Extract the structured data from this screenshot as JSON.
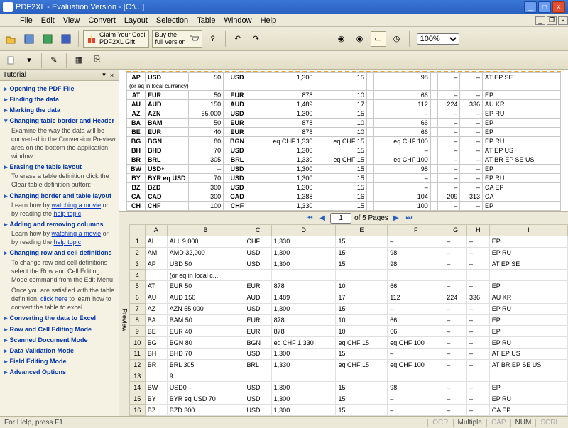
{
  "titlebar": {
    "app": "PDF2XL - Evaluation Version",
    "doc": "[C:\\...]"
  },
  "menu": [
    "File",
    "Edit",
    "View",
    "Convert",
    "Layout",
    "Selection",
    "Table",
    "Window",
    "Help"
  ],
  "toolbar": {
    "promo1a": "Claim Your Cool",
    "promo1b": "PDF2XL Gift",
    "promo2a": "Buy the",
    "promo2b": "full version",
    "zoom": "100%"
  },
  "tutorial": {
    "title": "Tutorial",
    "topics": [
      {
        "label": "Opening the PDF File",
        "open": false
      },
      {
        "label": "Finding the data",
        "open": false
      },
      {
        "label": "Marking the data",
        "open": false
      },
      {
        "label": "Changing table border and Header",
        "open": true,
        "body": "Examine the way the data will be converted in the Conversion Preview area on the bottom the application window."
      },
      {
        "label": "Erasing the table layout",
        "open": false,
        "body": "To erase a table definition click the Clear table definition button:"
      },
      {
        "label": "Changing border and table layout",
        "open": false,
        "body": "Learn how by watching a movie or by reading the help topic."
      },
      {
        "label": "Adding and removing columns",
        "open": false,
        "body": "Learn how by watching a movie or by reading the help topic."
      },
      {
        "label": "Changing row and cell definitions",
        "open": false,
        "body": "To change row and cell definitions select the Row and Cell Editing Mode command from the Edit Menu:"
      },
      {
        "label": "",
        "open": false,
        "body": "Once you are satisfied with the table definition, click here to learn how to convert the table to excel."
      },
      {
        "label": "Converting the data to Excel",
        "open": false
      },
      {
        "label": "Row and Cell Editing Mode",
        "open": false
      },
      {
        "label": "Scanned Document Mode",
        "open": false
      },
      {
        "label": "Data Validation Mode",
        "open": false
      },
      {
        "label": "Field Editing Mode",
        "open": false
      },
      {
        "label": "Advanced Options",
        "open": false
      }
    ]
  },
  "pdf_table": {
    "note": "(or eq in local currency)",
    "rows": [
      {
        "c": "AP",
        "cur": "USD",
        "v1": "50",
        "cur2": "USD",
        "v2": "1,300",
        "v3": "15",
        "v4": "",
        "v5": "98",
        "v6": "",
        "v7": "–",
        "v8": "–",
        "tx": "AT EP SE"
      },
      {
        "c": "AT",
        "cur": "EUR",
        "v1": "50",
        "cur2": "EUR",
        "v2": "878",
        "v3": "10",
        "v4": "",
        "v5": "66",
        "v6": "",
        "v7": "–",
        "v8": "–",
        "tx": "EP"
      },
      {
        "c": "AU",
        "cur": "AUD",
        "v1": "150",
        "cur2": "AUD",
        "v2": "1,489",
        "v3": "17",
        "v4": "",
        "v5": "112",
        "v6": "",
        "v7": "224",
        "v8": "336",
        "tx": "AU KR"
      },
      {
        "c": "AZ",
        "cur": "AZN",
        "v1": "55,000",
        "cur2": "USD",
        "v2": "1,300",
        "v3": "15",
        "v4": "",
        "v5": "–",
        "v6": "",
        "v7": "–",
        "v8": "–",
        "tx": "EP RU"
      },
      {
        "c": "BA",
        "cur": "BAM",
        "v1": "50",
        "cur2": "EUR",
        "v2": "878",
        "v3": "10",
        "v4": "",
        "v5": "66",
        "v6": "",
        "v7": "–",
        "v8": "–",
        "tx": "EP"
      },
      {
        "c": "BE",
        "cur": "EUR",
        "v1": "40",
        "cur2": "EUR",
        "v2": "878",
        "v3": "10",
        "v4": "",
        "v5": "66",
        "v6": "",
        "v7": "–",
        "v8": "–",
        "tx": "EP"
      },
      {
        "c": "BG",
        "cur": "BGN",
        "v1": "80",
        "cur2": "BGN",
        "v2": "eq CHF 1,330",
        "v3": "eq CHF 15",
        "v4": "",
        "v5": "eq CHF 100",
        "v6": "",
        "v7": "–",
        "v8": "–",
        "tx": "EP RU"
      },
      {
        "c": "BH",
        "cur": "BHD",
        "v1": "70",
        "cur2": "USD",
        "v2": "1,300",
        "v3": "15",
        "v4": "",
        "v5": "–",
        "v6": "",
        "v7": "–",
        "v8": "–",
        "tx": "AT EP US"
      },
      {
        "c": "BR",
        "cur": "BRL",
        "v1": "305",
        "cur2": "BRL",
        "v2": "1,330",
        "v3": "eq CHF 15",
        "v4": "",
        "v5": "eq CHF 100",
        "v6": "",
        "v7": "–",
        "v8": "–",
        "tx": "AT BR EP SE US"
      },
      {
        "c": "BW",
        "cur": "USD⁹",
        "v1": "–",
        "cur2": "USD",
        "v2": "1,300",
        "v3": "15",
        "v4": "",
        "v5": "98",
        "v6": "",
        "v7": "–",
        "v8": "–",
        "tx": "EP"
      },
      {
        "c": "BY",
        "cur": "BYR eq USD",
        "v1": "70",
        "cur2": "USD",
        "v2": "1,300",
        "v3": "15",
        "v4": "",
        "v5": "–",
        "v6": "",
        "v7": "–",
        "v8": "–",
        "tx": "EP RU"
      },
      {
        "c": "BZ",
        "cur": "BZD",
        "v1": "300",
        "cur2": "USD",
        "v2": "1,300",
        "v3": "15",
        "v4": "",
        "v5": "–",
        "v6": "",
        "v7": "–",
        "v8": "–",
        "tx": "CA EP"
      },
      {
        "c": "CA",
        "cur": "CAD",
        "v1": "300",
        "cur2": "CAD",
        "v2": "1,388",
        "v3": "16",
        "v4": "",
        "v5": "104",
        "v6": "",
        "v7": "209",
        "v8": "313",
        "tx": "CA"
      },
      {
        "c": "CH",
        "cur": "CHF",
        "v1": "100",
        "cur2": "CHF",
        "v2": "1,330",
        "v3": "15",
        "v4": "",
        "v5": "100",
        "v6": "",
        "v7": "–",
        "v8": "–",
        "tx": "EP"
      }
    ]
  },
  "pager": {
    "current": "1",
    "total": "of 5 Pages"
  },
  "sheet": {
    "cols": [
      "A",
      "B",
      "C",
      "D",
      "E",
      "F",
      "G",
      "H",
      "I"
    ],
    "label": "Preview",
    "rows": [
      {
        "n": "1",
        "a": "AL",
        "b": "ALL 9,000",
        "c": "CHF",
        "d": "1,330",
        "e": "15",
        "f": "–",
        "g": "–",
        "h": "–",
        "i": "EP"
      },
      {
        "n": "2",
        "a": "AM",
        "b": "AMD 32,000",
        "c": "USD",
        "d": "1,300",
        "e": "15",
        "f": "98",
        "g": "–",
        "h": "–",
        "i": "EP RU"
      },
      {
        "n": "3",
        "a": "AP",
        "b": "USD 50",
        "c": "USD",
        "d": "1,300",
        "e": "15",
        "f": "98",
        "g": "–",
        "h": "–",
        "i": "AT EP SE"
      },
      {
        "n": "4",
        "a": "",
        "b": "(or eq in local c...",
        "c": "",
        "d": "",
        "e": "",
        "f": "",
        "g": "",
        "h": "",
        "i": ""
      },
      {
        "n": "5",
        "a": "AT",
        "b": "EUR 50",
        "c": "EUR",
        "d": "878",
        "e": "10",
        "f": "66",
        "g": "–",
        "h": "–",
        "i": "EP"
      },
      {
        "n": "6",
        "a": "AU",
        "b": "AUD 150",
        "c": "AUD",
        "d": "1,489",
        "e": "17",
        "f": "112",
        "g": "224",
        "h": "336",
        "i": "AU KR"
      },
      {
        "n": "7",
        "a": "AZ",
        "b": "AZN 55,000",
        "c": "USD",
        "d": "1,300",
        "e": "15",
        "f": "–",
        "g": "–",
        "h": "–",
        "i": "EP RU"
      },
      {
        "n": "8",
        "a": "BA",
        "b": "BAM 50",
        "c": "EUR",
        "d": "878",
        "e": "10",
        "f": "66",
        "g": "–",
        "h": "–",
        "i": "EP"
      },
      {
        "n": "9",
        "a": "BE",
        "b": "EUR 40",
        "c": "EUR",
        "d": "878",
        "e": "10",
        "f": "66",
        "g": "–",
        "h": "–",
        "i": "EP"
      },
      {
        "n": "10",
        "a": "BG",
        "b": "BGN 80",
        "c": "BGN",
        "d": "eq CHF 1,330",
        "e": "eq CHF 15",
        "f": "eq CHF 100",
        "g": "–",
        "h": "–",
        "i": "EP RU"
      },
      {
        "n": "11",
        "a": "BH",
        "b": "BHD 70",
        "c": "USD",
        "d": "1,300",
        "e": "15",
        "f": "–",
        "g": "–",
        "h": "–",
        "i": "AT EP US"
      },
      {
        "n": "12",
        "a": "BR",
        "b": "BRL 305",
        "c": "BRL",
        "d": "1,330",
        "e": "eq CHF 15",
        "f": "eq CHF 100",
        "g": "–",
        "h": "–",
        "i": "AT BR EP SE US"
      },
      {
        "n": "13",
        "a": "",
        "b": "9",
        "c": "",
        "d": "",
        "e": "",
        "f": "",
        "g": "",
        "h": "",
        "i": ""
      },
      {
        "n": "14",
        "a": "BW",
        "b": "USD0 –",
        "c": "USD",
        "d": "1,300",
        "e": "15",
        "f": "98",
        "g": "–",
        "h": "–",
        "i": "EP"
      },
      {
        "n": "15",
        "a": "BY",
        "b": "BYR eq USD 70",
        "c": "USD",
        "d": "1,300",
        "e": "15",
        "f": "–",
        "g": "–",
        "h": "–",
        "i": "EP RU"
      },
      {
        "n": "16",
        "a": "BZ",
        "b": "BZD 300",
        "c": "USD",
        "d": "1,300",
        "e": "15",
        "f": "–",
        "g": "–",
        "h": "–",
        "i": "CA EP"
      }
    ]
  },
  "status": {
    "help": "For Help, press F1",
    "ocr": "OCR",
    "multi": "Multiple",
    "cap": "CAP",
    "num": "NUM",
    "scrl": "SCRL"
  }
}
